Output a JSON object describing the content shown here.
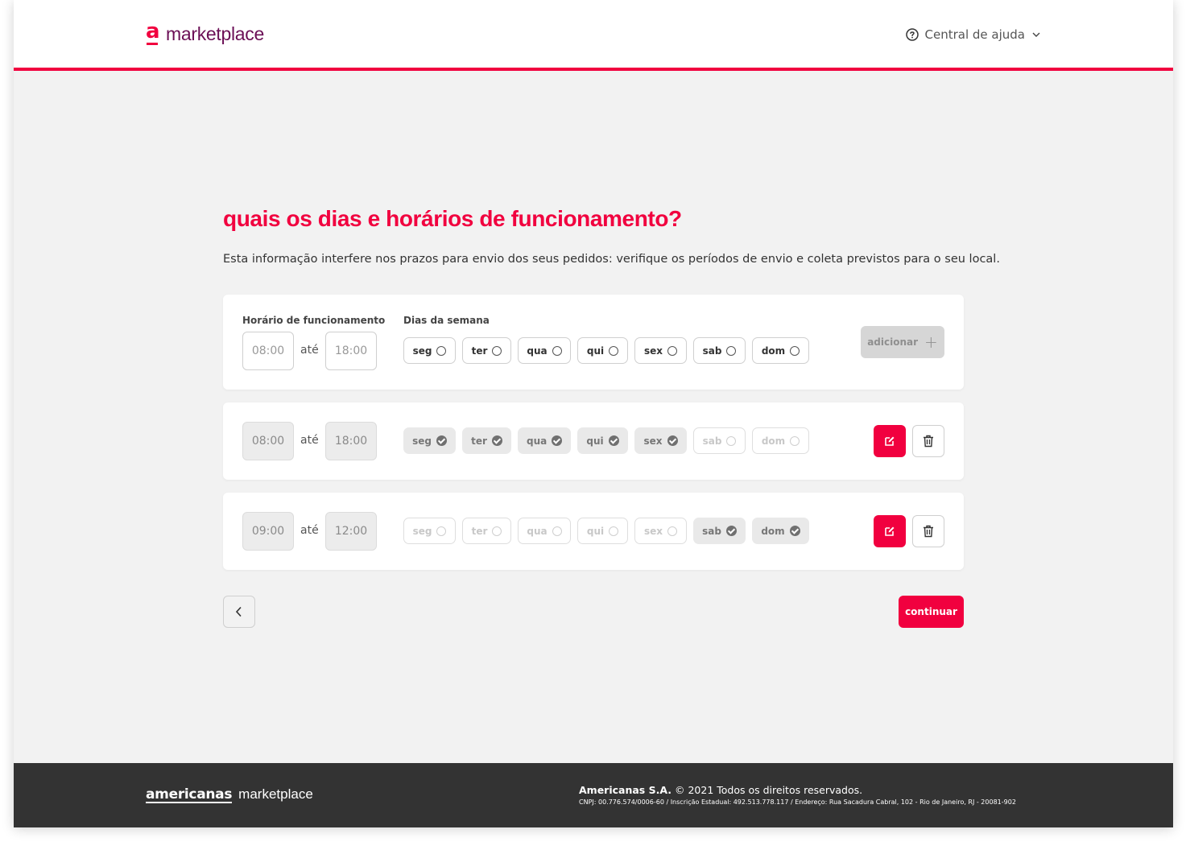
{
  "header": {
    "logo_text": "marketplace",
    "help_label": "Central de ajuda"
  },
  "main": {
    "title": "quais os dias e horários de funcionamento?",
    "subtitle": "Esta informação interfere nos prazos para envio dos seus pedidos: verifique os períodos de envio e coleta previstos para o seu local.",
    "hours_label": "Horário de funcionamento",
    "days_label": "Dias da semana",
    "until_label": "até",
    "add_label": "adicionar",
    "continue_label": "continuar"
  },
  "new_entry": {
    "start_placeholder": "08:00",
    "end_placeholder": "18:00",
    "days": [
      {
        "label": "seg",
        "selected": false
      },
      {
        "label": "ter",
        "selected": false
      },
      {
        "label": "qua",
        "selected": false
      },
      {
        "label": "qui",
        "selected": false
      },
      {
        "label": "sex",
        "selected": false
      },
      {
        "label": "sab",
        "selected": false
      },
      {
        "label": "dom",
        "selected": false
      }
    ]
  },
  "schedules": [
    {
      "start": "08:00",
      "end": "18:00",
      "days": [
        {
          "label": "seg",
          "selected": true
        },
        {
          "label": "ter",
          "selected": true
        },
        {
          "label": "qua",
          "selected": true
        },
        {
          "label": "qui",
          "selected": true
        },
        {
          "label": "sex",
          "selected": true
        },
        {
          "label": "sab",
          "selected": false
        },
        {
          "label": "dom",
          "selected": false
        }
      ]
    },
    {
      "start": "09:00",
      "end": "12:00",
      "days": [
        {
          "label": "seg",
          "selected": false
        },
        {
          "label": "ter",
          "selected": false
        },
        {
          "label": "qua",
          "selected": false
        },
        {
          "label": "qui",
          "selected": false
        },
        {
          "label": "sex",
          "selected": false
        },
        {
          "label": "sab",
          "selected": true
        },
        {
          "label": "dom",
          "selected": true
        }
      ]
    }
  ],
  "footer": {
    "brand": "americanas",
    "brand_suffix": "marketplace",
    "company": "Americanas S.A.",
    "copyright": "© 2021 Todos os direitos reservados.",
    "legal": "CNPJ: 00.776.574/0006-60 / Inscrição Estadual: 492.513.778.117 / Endereço: Rua Sacadura Cabral, 102 - Rio de Janeiro, RJ - 20081-902"
  },
  "colors": {
    "brand_red": "#f1003f",
    "logo_purple": "#6b0f56",
    "footer_bg": "#333333"
  }
}
